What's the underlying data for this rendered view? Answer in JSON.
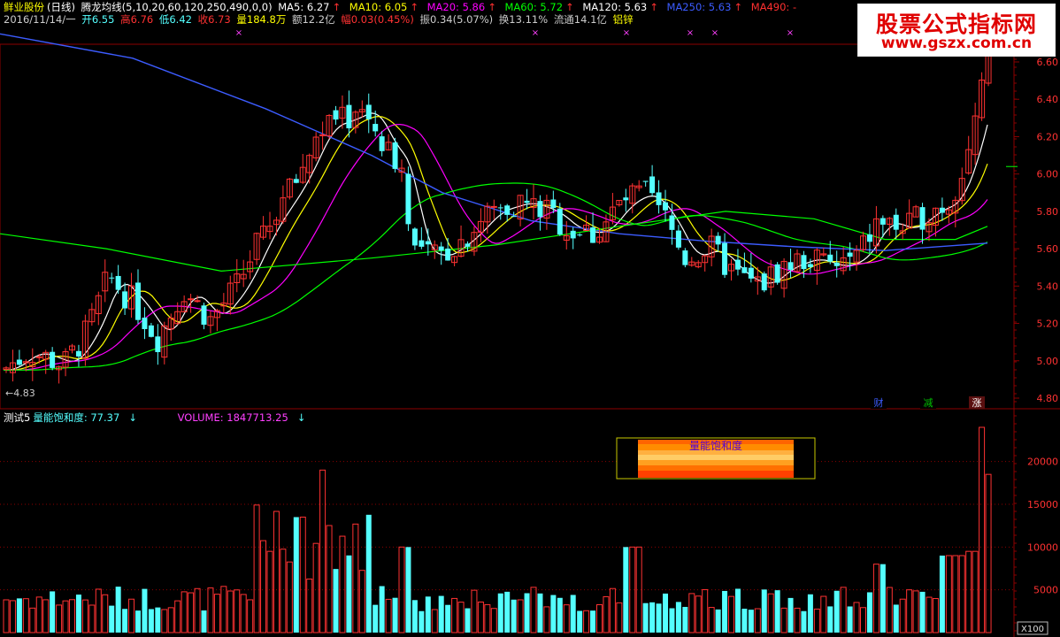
{
  "header": {
    "stock_name": "鲜业股份",
    "period": "(日线)",
    "indicator": "腾龙均线(5,10,20,60,120,250,490,0,0)",
    "ma": [
      {
        "label": "MA5: 6.27",
        "arrow": "↑",
        "color": "#ffffff"
      },
      {
        "label": "MA10: 6.05",
        "arrow": "↑",
        "color": "#ffff00"
      },
      {
        "label": "MA20: 5.86",
        "arrow": "↑",
        "color": "#ff00ff"
      },
      {
        "label": "MA60: 5.72",
        "arrow": "↑",
        "color": "#00ff00"
      },
      {
        "label": "MA120: 5.63",
        "arrow": "↑",
        "color": "#ffffff"
      },
      {
        "label": "MA250: 5.63",
        "arrow": "↑",
        "color": "#3c5cff"
      },
      {
        "label": "MA490: -",
        "arrow": "",
        "color": "#ff3030"
      }
    ],
    "quote": {
      "date": "2016/11/14/一",
      "open": "开6.55",
      "high": "高6.76",
      "low": "低6.42",
      "close": "收6.73",
      "vol": "量184.8万",
      "amount": "额12.2亿",
      "pct": "幅0.03(0.45%)",
      "amp": "振0.34(5.07%)",
      "turnover": "换13.11%",
      "float": "流通14.1亿",
      "industry": "铝锌"
    }
  },
  "watermark": {
    "title": "股票公式指标网",
    "url": "www.gszx.com.cn"
  },
  "price_axis": {
    "labels": [
      "6.60",
      "6.40",
      "6.20",
      "6.00",
      "5.80",
      "5.60",
      "5.40",
      "5.20",
      "5.00",
      "4.80"
    ],
    "min_label": "←4.83"
  },
  "markers": {
    "fin": "财",
    "reduce": "减",
    "rise": "涨"
  },
  "volume_panel": {
    "indicator_name": "测试5",
    "saturation_label": "量能饱和度: 77.37",
    "saturation_arrow": "↓",
    "volume_label": "VOLUME: 1847713.25",
    "volume_arrow": "↓",
    "box_title": "量能饱和度",
    "axis_labels": [
      "20000",
      "15000",
      "10000",
      "5000"
    ],
    "unit": "X100"
  },
  "colors": {
    "up": "#ff3232",
    "down": "#54ffff",
    "ma5": "#ffffff",
    "ma10": "#ffff00",
    "ma20": "#ff00ff",
    "ma60": "#00ff00",
    "ma250": "#3c5cff",
    "grid": "#8b0000"
  }
}
